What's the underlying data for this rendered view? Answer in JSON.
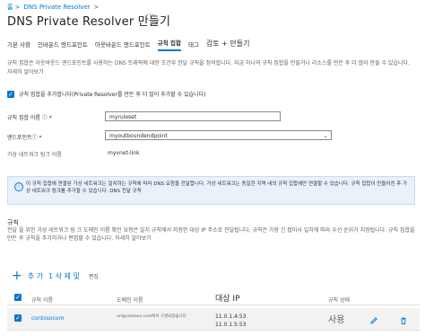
{
  "breadcrumb": {
    "home": "홈 >",
    "resolver": "DNS Private Resolver",
    "sep": ">"
  },
  "page": {
    "title": "DNS  Private  Resolver  만들기",
    "more": "···"
  },
  "tabs": [
    {
      "label": "기본 사항"
    },
    {
      "label": "인바운드 엔드포인트"
    },
    {
      "label": "아웃바운드 엔드포인트"
    },
    {
      "label": "규칙 집합"
    },
    {
      "label": "태그"
    },
    {
      "label": "검토 + 만들기"
    }
  ],
  "description": "규칙 집합은 아웃바운드 엔드포인트를 사용하는 DNS 트래픽에 대한 조건부 전달 규칙을 정의합니다. 지금 하나의 규칙 집합을 만들거나 리소스를 만든 후 더 많이 만들 수 있습니다. 자세히 알아보기",
  "checkbox": {
    "label": "규칙 집합을 추가합니다(Private Resolver를 만든 후 더 많이 추가할 수 있습니다)",
    "checked_glyph": "✓"
  },
  "form": {
    "ruleset_name_label": "규칙 집합 이름 ⓘ *",
    "ruleset_name_value": "myruleset",
    "endpoint_label": "엔드포인트ⓘ *",
    "endpoint_value": "myoutboundendpoint",
    "vnet_link_label": "가상 네트워크 링크 이름",
    "vnet_link_value": "myvnet-link"
  },
  "info": {
    "icon": "ⓘ",
    "text": "이 규칙 집합에 연결된 가상 네트워크는 일치하는 규칙에 따라 DNS 요청을 전달합니다. 가상 네트워크는 동일한 지역 내의 규칙 집합에만 연결할 수 있습니다. 규칙 집합이 만들어진 후 가상 네트워크 링크를 추가할 수 있습니다. DNS 전달 규칙"
  },
  "rules": {
    "title": "규칙",
    "description": "전달 을 위한 가상 네트워크 링 크 도메인 이름 확인 요청은 일치 규칙에서 지정한 대상 IP 주소로 전달됩니다. 규칙은 가장 긴 접미사 일치에 따라 우선 순위가 지정됩니다. 규칙 집합을 만든 후 규칙을 추가하거나 편집할 수 있습니다. 자세히 알아보기",
    "toolbar": {
      "plus": "+",
      "add": "추 가",
      "delete": "1 삭 제 및",
      "edit": "편집"
    },
    "columns": [
      "규칙 이름",
      "도메인 이름",
      "대상 IP",
      "규칙 상태"
    ],
    "rows": [
      {
        "name": "contosocom",
        "domain": "url@contoso.com에서 구성되었습니다",
        "ip1": "11.0.1.4:53",
        "ip2": "11.0.1.5:53",
        "status": "사용"
      }
    ]
  },
  "colors": {
    "accent": "#0078d4",
    "info_bg": "#e9f1fb"
  }
}
